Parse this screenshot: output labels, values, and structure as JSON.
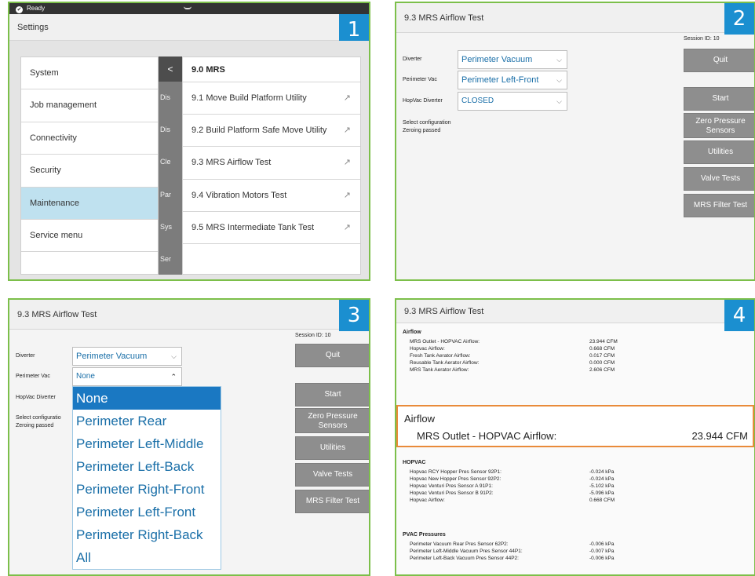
{
  "panels": {
    "p1": {
      "badge": "1",
      "status": "Ready",
      "title": "Settings",
      "menu": [
        "System",
        "Job management",
        "Connectivity",
        "Security",
        "Maintenance",
        "Service menu"
      ],
      "sub": [
        "Dis",
        "Dis",
        "Cle",
        "Par",
        "Sys",
        "Ser"
      ],
      "back": "<",
      "mrs_header": "9.0 MRS",
      "mrs_items": [
        "9.1 Move Build Platform Utility",
        "9.2 Build Platform Safe Move Utility",
        "9.3 MRS Airflow Test",
        "9.4 Vibration Motors Test",
        "9.5 MRS Intermediate Tank Test"
      ],
      "arrow": "↗"
    },
    "p2": {
      "badge": "2",
      "title": "9.3 MRS Airflow Test",
      "session": "Session ID: 10",
      "diverter_label": "Diverter",
      "diverter_value": "Perimeter Vacuum",
      "pvac_label": "Perimeter Vac",
      "pvac_value": "Perimeter Left-Front",
      "hop_label": "HopVac Diverter",
      "hop_value": "CLOSED",
      "msg1": "Select configuration",
      "msg2": "Zeroing passed",
      "buttons": {
        "quit": "Quit",
        "start": "Start",
        "zero": "Zero Pressure Sensors",
        "utilities": "Utilities",
        "valve": "Valve Tests",
        "filter": "MRS Filter Test"
      },
      "caret_down": "⌵"
    },
    "p3": {
      "badge": "3",
      "title": "9.3 MRS Airflow Test",
      "session": "Session ID: 10",
      "diverter_label": "Diverter",
      "diverter_value": "Perimeter Vacuum",
      "pvac_label": "Perimeter Vac",
      "pvac_value": "None",
      "hop_label": "HopVac Diverter",
      "msg1": "Select configuratio",
      "msg2": "Zeroing passed",
      "options": [
        "None",
        "Perimeter Rear",
        "Perimeter Left-Middle",
        "Perimeter Left-Back",
        "Perimeter Right-Front",
        "Perimeter Left-Front",
        "Perimeter Right-Back",
        "All"
      ],
      "buttons": {
        "quit": "Quit",
        "start": "Start",
        "zero": "Zero Pressure Sensors",
        "utilities": "Utilities",
        "valve": "Valve Tests",
        "filter": "MRS Filter Test"
      },
      "caret_down": "⌵",
      "caret_up": "⌃"
    },
    "p4": {
      "badge": "4",
      "title": "9.3 MRS Airflow Test",
      "airflow_title": "Airflow",
      "airflow": [
        {
          "k": "MRS Outlet - HOPVAC Airflow:",
          "v": "23.944 CFM"
        },
        {
          "k": "Hopvac Airflow:",
          "v": "0.668 CFM"
        },
        {
          "k": "Fresh Tank Aerator Airflow:",
          "v": "0.017 CFM"
        },
        {
          "k": "Reusable Tank Aerator Airflow:",
          "v": "0.000 CFM"
        },
        {
          "k": "MRS Tank Aerator Airflow:",
          "v": "2.606 CFM"
        }
      ],
      "highlight_title": "Airflow",
      "highlight_label": "MRS Outlet - HOPVAC Airflow:",
      "highlight_value": "23.944 CFM",
      "hopvac_title": "HOPVAC",
      "hopvac": [
        {
          "k": "Hopvac RCY Hopper Pres Sensor 92P1:",
          "v": "-0.024 kPa"
        },
        {
          "k": "Hopvac New Hopper Pres Sensor 92P2:",
          "v": "-0.024 kPa"
        },
        {
          "k": "Hopvac Venturi Pres Sensor A 91P1:",
          "v": "-5.102 kPa"
        },
        {
          "k": "Hopvac Venturi Pres Sensor B 91P2:",
          "v": "-5.096 kPa"
        },
        {
          "k": "Hopvac Airflow:",
          "v": "0.668 CFM"
        }
      ],
      "pvac_title": "PVAC Pressures",
      "pvac": [
        {
          "k": "Perimeter Vacuum Rear Pres Sensor 62P2:",
          "v": "-0.006 kPa"
        },
        {
          "k": "Perimeter Left-Middle Vacuum Pres Sensor 44P1:",
          "v": "-0.007 kPa"
        },
        {
          "k": "Perimeter Left-Back Vacuum Pres Sensor 44P2:",
          "v": "-0.006 kPa"
        }
      ]
    }
  }
}
